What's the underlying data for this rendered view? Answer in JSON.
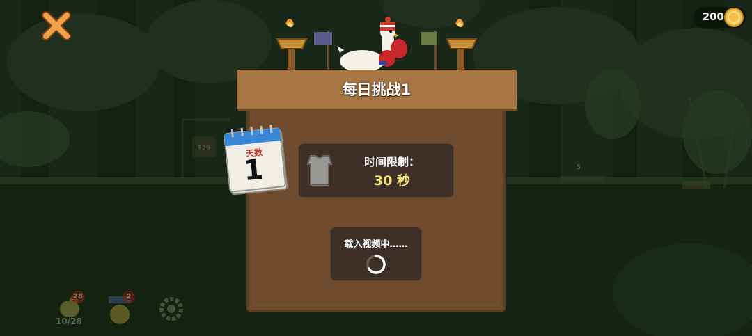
{
  "hud": {
    "close_icon": "close-x-icon",
    "coins": "200",
    "coin_icon": "gold-coin-icon"
  },
  "dialog": {
    "title": "每日挑战1",
    "calendar": {
      "header": "天数",
      "day": "1"
    },
    "time_limit": {
      "label": "时间限制：",
      "value": "30 秒",
      "icon": "shirt-icon"
    },
    "video": {
      "label": "载入视频中……",
      "icon": "loading-spinner-icon"
    }
  },
  "background": {
    "badge_left": "28",
    "badge_mid": "2",
    "progress": "10/28",
    "signpost": "129",
    "marker": "5"
  },
  "colors": {
    "accent_orange": "#f0a04a",
    "coin_gold": "#f2c04a",
    "time_value": "#f4e27a",
    "board_wood": "#7a5434"
  }
}
